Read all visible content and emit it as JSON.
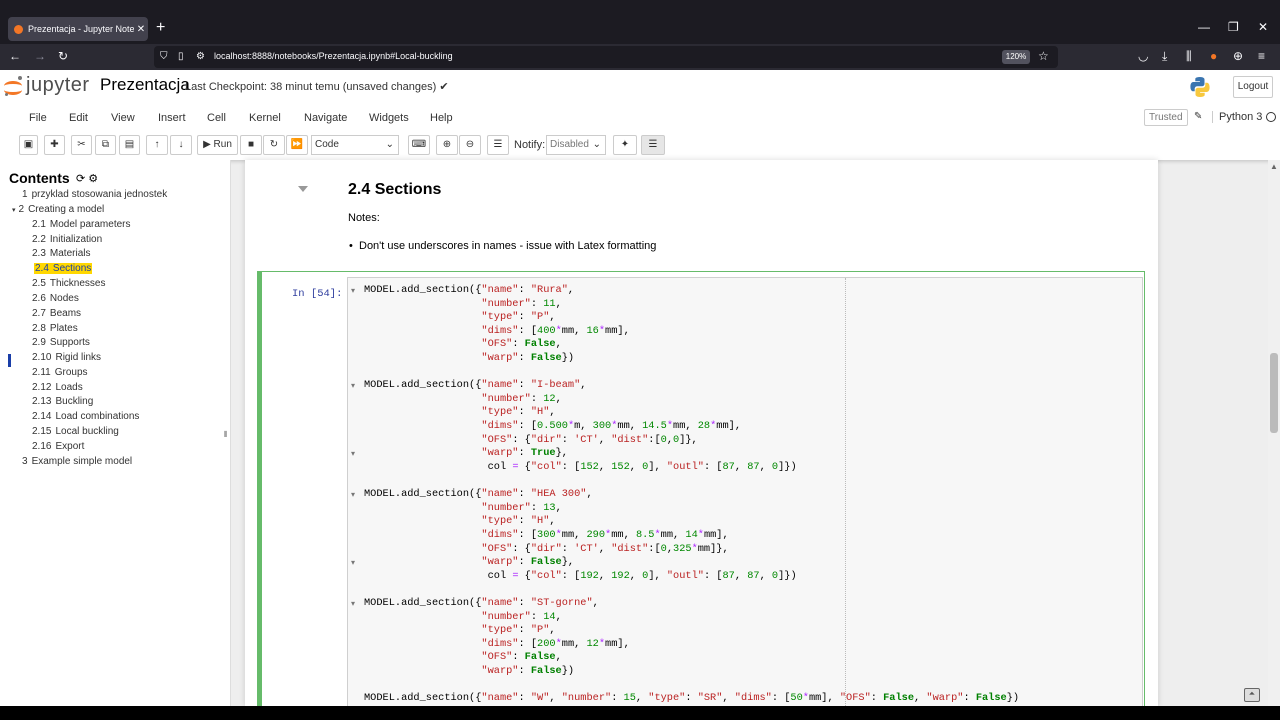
{
  "browser": {
    "tab_title": "Prezentacja - Jupyter Notebook",
    "tab_close": "✕",
    "new_tab": "+",
    "url": "localhost:8888/notebooks/Prezentacja.ipynb#Local-buckling",
    "zoom": "120%",
    "win_min": "—",
    "win_max": "❐",
    "win_close": "✕"
  },
  "header": {
    "logo_text": "jupyter",
    "notebook_name": "Prezentacja",
    "checkpoint": "Last Checkpoint: 38 minut temu   (unsaved changes) ✔",
    "logout": "Logout"
  },
  "menu": {
    "items": [
      "File",
      "Edit",
      "View",
      "Insert",
      "Cell",
      "Kernel",
      "Navigate",
      "Widgets",
      "Help"
    ],
    "trusted": "Trusted",
    "kernel": "Python 3"
  },
  "toolbar": {
    "run": "▶ Run",
    "cell_type": "Code",
    "notify_label": "Notify:",
    "notify_value": "Disabled"
  },
  "toc": {
    "title": "Contents",
    "items": [
      {
        "num": "1",
        "label": "przyklad stosowania jednostek"
      },
      {
        "num": "2",
        "label": "Creating a model"
      },
      {
        "num": "2.1",
        "label": "Model parameters"
      },
      {
        "num": "2.2",
        "label": "Initialization"
      },
      {
        "num": "2.3",
        "label": "Materials"
      },
      {
        "num": "2.4",
        "label": "Sections"
      },
      {
        "num": "2.5",
        "label": "Thicknesses"
      },
      {
        "num": "2.6",
        "label": "Nodes"
      },
      {
        "num": "2.7",
        "label": "Beams"
      },
      {
        "num": "2.8",
        "label": "Plates"
      },
      {
        "num": "2.9",
        "label": "Supports"
      },
      {
        "num": "2.10",
        "label": "Rigid links"
      },
      {
        "num": "2.11",
        "label": "Groups"
      },
      {
        "num": "2.12",
        "label": "Loads"
      },
      {
        "num": "2.13",
        "label": "Buckling"
      },
      {
        "num": "2.14",
        "label": "Load combinations"
      },
      {
        "num": "2.15",
        "label": "Local buckling"
      },
      {
        "num": "2.16",
        "label": "Export"
      },
      {
        "num": "3",
        "label": "Example simple model"
      }
    ]
  },
  "notebook": {
    "heading": "2.4  Sections",
    "notes": "Notes:",
    "bullet": "Don't use underscores in names - issue with Latex formatting",
    "prompt": "In [54]:"
  }
}
